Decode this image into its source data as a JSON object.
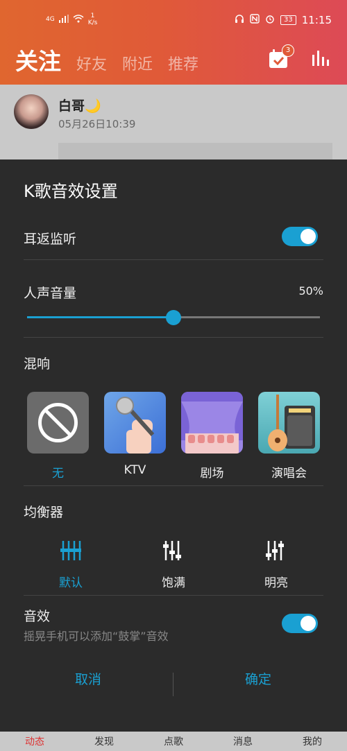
{
  "status_bar": {
    "network": "4G",
    "speed_value": "1",
    "speed_unit": "K/s",
    "battery": "33",
    "time": "11:15"
  },
  "header": {
    "tabs": [
      "关注",
      "好友",
      "附近",
      "推荐"
    ],
    "active_tab": "关注",
    "calendar_badge": "3"
  },
  "feed_post": {
    "name": "白哥🌙",
    "time": "05月26日10:39"
  },
  "sheet": {
    "title": "K歌音效设置",
    "ear_monitor": {
      "label": "耳返监听",
      "enabled": true
    },
    "vocal_volume": {
      "label": "人声音量",
      "value_text": "50%",
      "value": 0.5
    },
    "reverb": {
      "label": "混响",
      "options": [
        "无",
        "KTV",
        "剧场",
        "演唱会"
      ],
      "selected": "无"
    },
    "equalizer": {
      "label": "均衡器",
      "options": [
        "默认",
        "饱满",
        "明亮"
      ],
      "selected": "默认"
    },
    "sound_effect": {
      "label": "音效",
      "description": "摇晃手机可以添加“鼓掌”音效",
      "enabled": true
    },
    "cancel": "取消",
    "confirm": "确定"
  },
  "bottom_nav": [
    "动态",
    "发现",
    "点歌",
    "消息",
    "我的"
  ],
  "bottom_nav_active": "动态",
  "colors": {
    "accent": "#1aa0d2",
    "header_start": "#e0662f",
    "header_end": "#dd4a56"
  }
}
